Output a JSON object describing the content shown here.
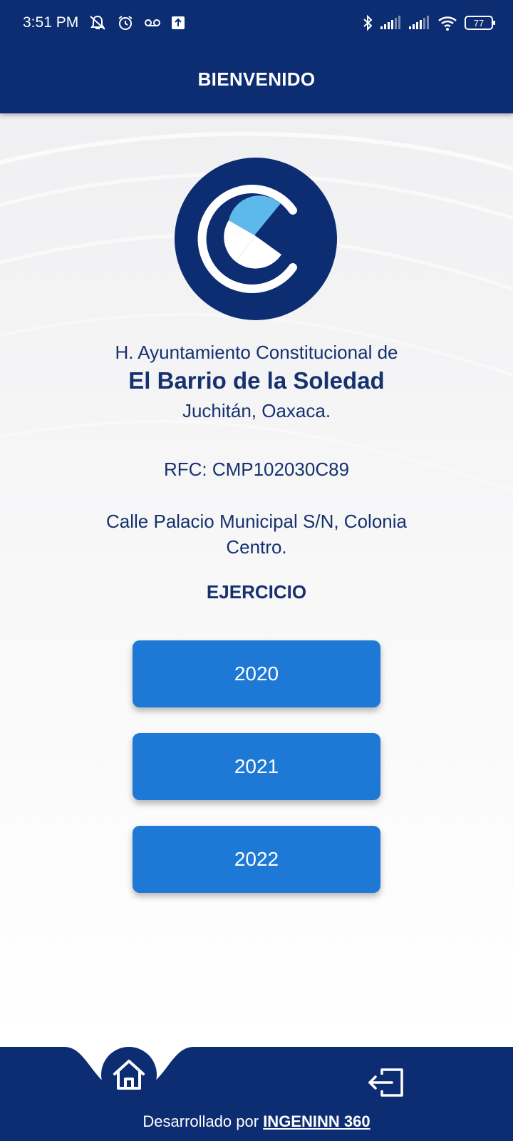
{
  "status_bar": {
    "time": "3:51 PM",
    "icons_left": [
      "mute-icon",
      "alarm-icon",
      "voicemail-icon",
      "upload-icon"
    ],
    "icons_right": [
      "bluetooth-icon",
      "signal-icon",
      "signal-icon",
      "wifi-icon",
      "battery-icon"
    ],
    "battery": "77"
  },
  "header": {
    "title": "BIENVENIDO"
  },
  "organization": {
    "line1": "H. Ayuntamiento Constitucional de",
    "name": "El Barrio de la Soledad",
    "location": "Juchitán, Oaxaca.",
    "rfc": "RFC: CMP102030C89",
    "address": "Calle Palacio Municipal S/N, Colonia Centro."
  },
  "ejercicio": {
    "label": "EJERCICIO",
    "years": [
      "2020",
      "2021",
      "2022"
    ]
  },
  "footer": {
    "credit_prefix": "Desarrollado por",
    "credit_link": "INGENINN 360"
  },
  "colors": {
    "primary_navy": "#0d2d72",
    "button_blue": "#1d78d6",
    "logo_light_blue": "#5db8ec",
    "text_navy": "#15316e"
  }
}
